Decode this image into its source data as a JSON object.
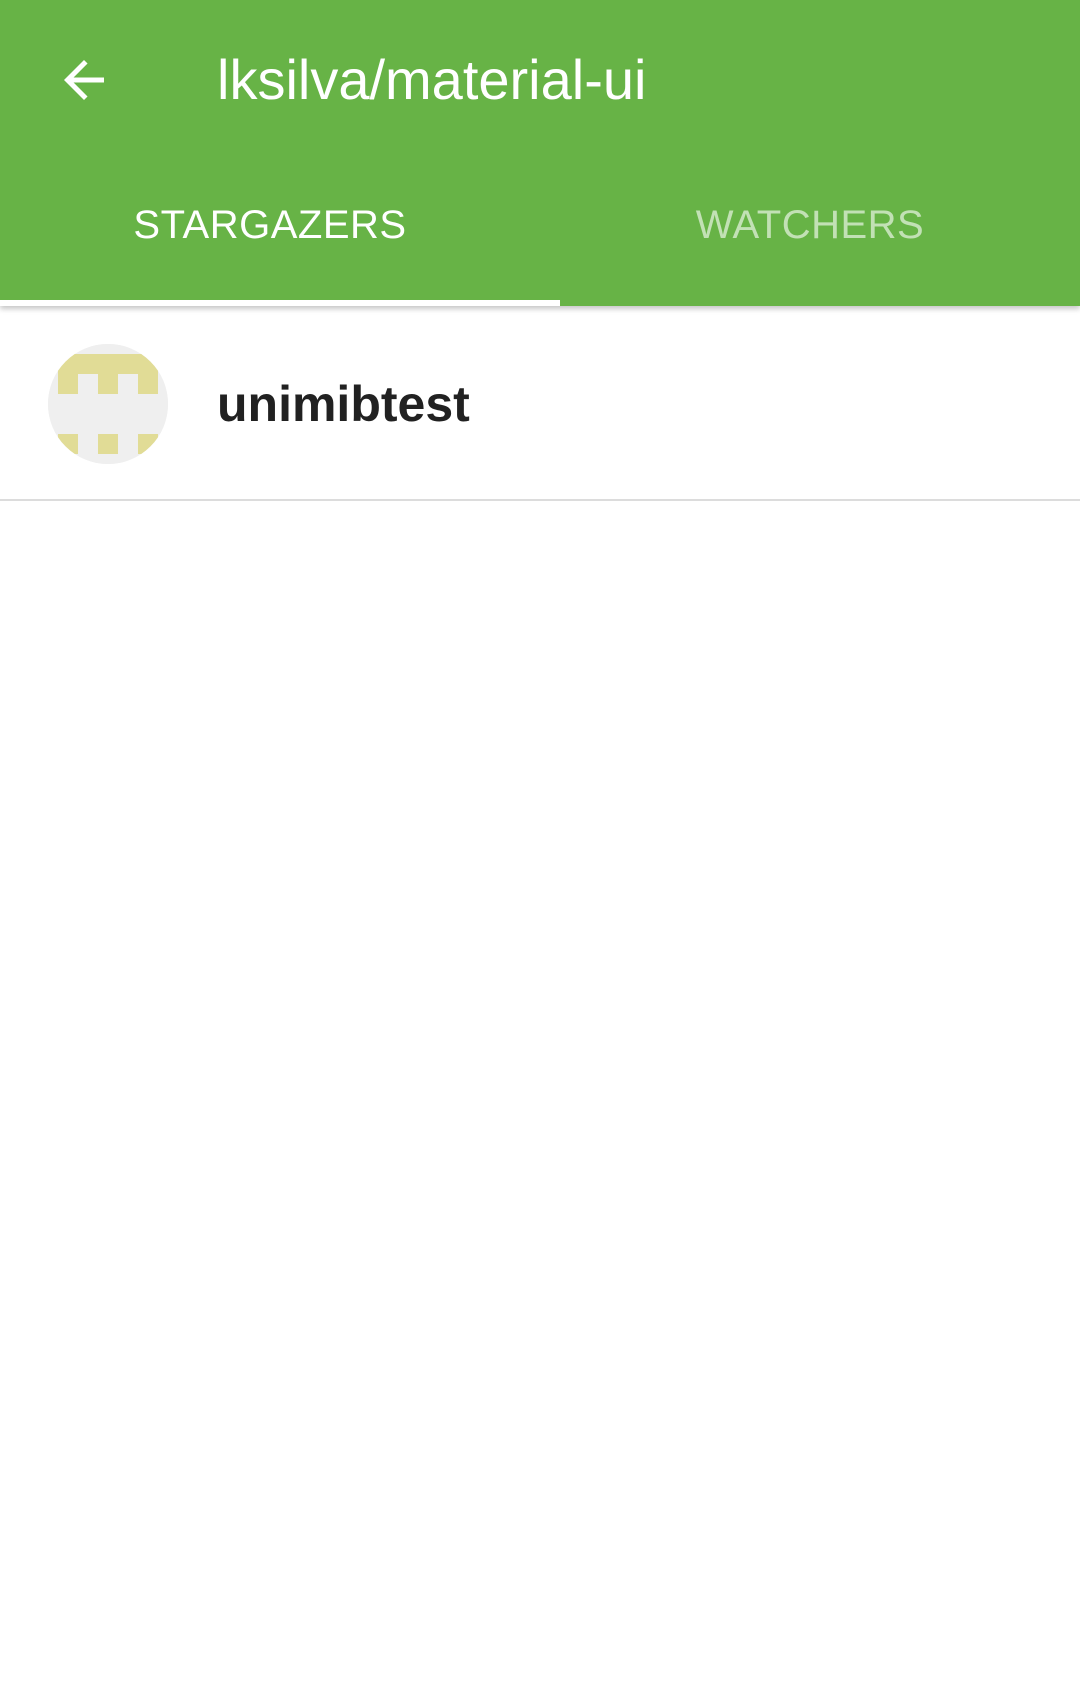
{
  "app_bar": {
    "title": "lksilva/material-ui",
    "back_icon": "arrow-back-icon",
    "background_color": "#67b346"
  },
  "tabs": [
    {
      "label": "STARGAZERS",
      "selected": true
    },
    {
      "label": "WATCHERS",
      "selected": false
    }
  ],
  "stargazers": [
    {
      "username": "unimibtest",
      "avatar_icon": "identicon-avatar",
      "avatar_color": "#e1dc96"
    }
  ]
}
